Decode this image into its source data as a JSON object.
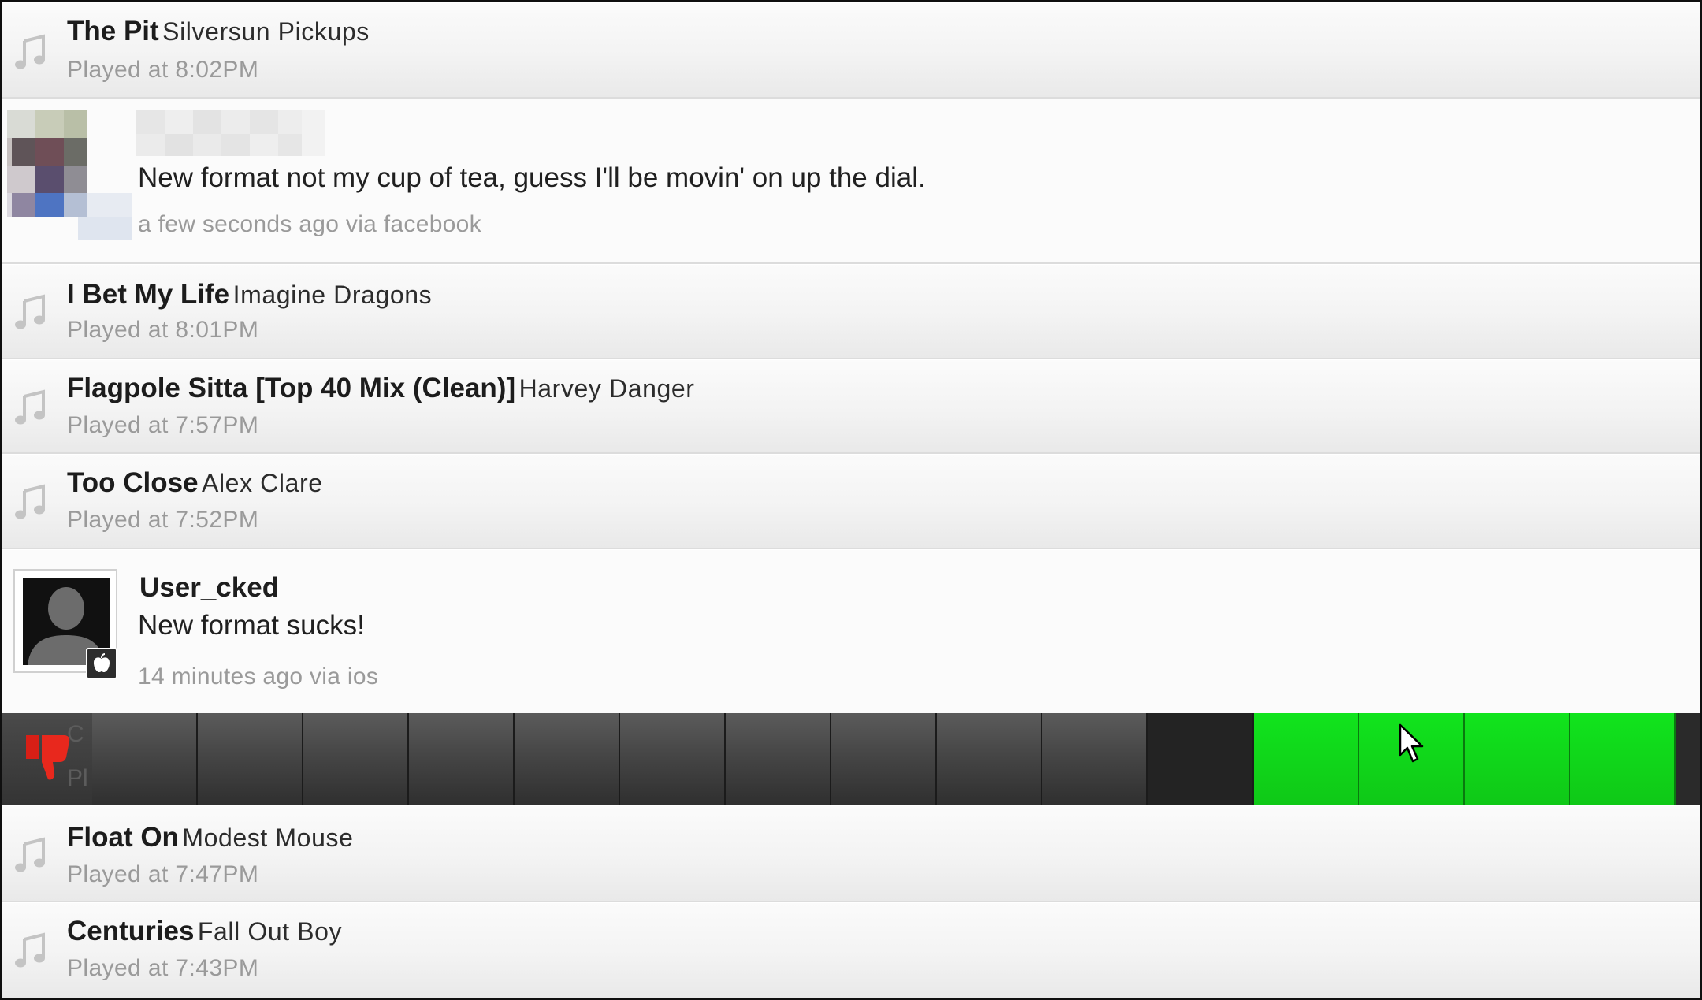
{
  "feed": {
    "songs_top": [
      {
        "title": "The Pit",
        "artist": "Silversun Pickups",
        "played": "Played at 8:02PM"
      }
    ],
    "comment_1": {
      "message": "New format not my cup of tea, guess I'll be movin' on up the dial.",
      "meta": "a few seconds ago via facebook"
    },
    "songs_mid": [
      {
        "title": "I Bet My Life",
        "artist": "Imagine Dragons",
        "played": "Played at 8:01PM"
      },
      {
        "title": "Flagpole Sitta [Top 40 Mix (Clean)]",
        "artist": "Harvey Danger",
        "played": "Played at 7:57PM"
      },
      {
        "title": "Too Close",
        "artist": "Alex Clare",
        "played": "Played at 7:52PM"
      }
    ],
    "comment_2": {
      "username": "User_cked",
      "message": "New format sucks!",
      "meta": "14 minutes ago via ios"
    },
    "vote_bar": {
      "segments_total": 15,
      "rating_fraction": 0.27,
      "ghost_title": "C",
      "ghost_played": "Pl",
      "colors": {
        "dislike": "#e0241b",
        "like": "#12d41b",
        "neutral": "#444444"
      }
    },
    "songs_bottom": [
      {
        "title": "Float On",
        "artist": "Modest Mouse",
        "played": "Played at 7:47PM"
      },
      {
        "title": "Centuries",
        "artist": "Fall Out Boy",
        "played": "Played at 7:43PM"
      }
    ]
  },
  "icons": {
    "song": "music-note-icon",
    "dislike": "thumbs-down-icon",
    "platform": "apple-icon",
    "pointer": "mouse-cursor-icon"
  }
}
